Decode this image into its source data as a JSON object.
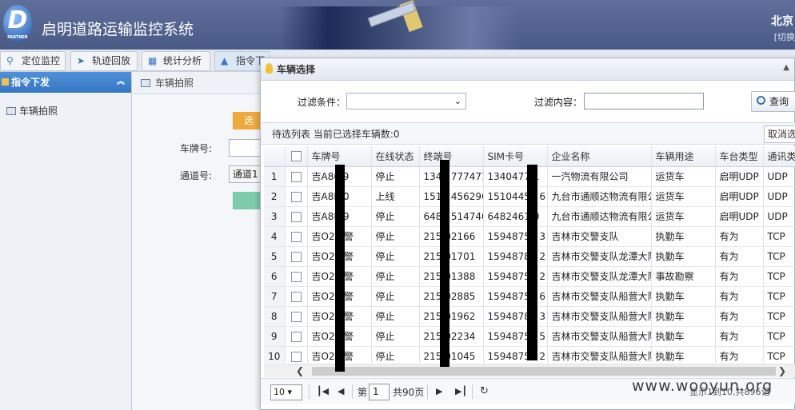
{
  "header": {
    "logo_letter": "D",
    "logo_sub": "PARTNER",
    "title": "启明道路运输监控系统",
    "city": "北京",
    "switch_link": "[切换"
  },
  "nav": {
    "tabs": [
      {
        "label": "定位监控",
        "icon": "pin-icon"
      },
      {
        "label": "轨迹回放",
        "icon": "send-icon"
      },
      {
        "label": "统计分析",
        "icon": "bar-chart-icon"
      },
      {
        "label": "指令下",
        "icon": "chart-area-icon"
      }
    ]
  },
  "sidebar": {
    "header": "指令下发",
    "items": [
      {
        "label": "车辆拍照"
      }
    ]
  },
  "content": {
    "tab_title": "车辆拍照",
    "select_btn": "选",
    "plate_label": "车牌号:",
    "channel_label": "通道号:",
    "channel_value": "通道1"
  },
  "dialog": {
    "title": "车辆选择",
    "filter_condition_label": "过滤条件：",
    "filter_condition_value": "",
    "filter_content_label": "过滤内容：",
    "filter_content_value": "",
    "query_btn": "查询",
    "list_status": "待选列表  当前已选择车辆数:0",
    "cancel_btn": "取消选",
    "columns": [
      "车牌号",
      "在线状态",
      "终端号",
      "SIM卡号",
      "企业名称",
      "车辆用途",
      "车台类型",
      "通讯类"
    ],
    "rows": [
      [
        "1",
        "吉A86  9",
        "停止",
        "1340 777471",
        "1340477  1",
        "一汽物流有限公司",
        "运货车",
        "启明UDP",
        "UDP"
      ],
      [
        "2",
        "吉A8K  0",
        "上线",
        "1510 456296",
        "15104456  6",
        "九台市通顺达物流有限公",
        "运货车",
        "启明UDP",
        "UDP"
      ],
      [
        "3",
        "吉A8K  9",
        "停止",
        "6482 514740",
        "6482461  0",
        "九台市通顺达物流有限公",
        "运货车",
        "启明UDP",
        "UDP"
      ],
      [
        "4",
        "吉O22  警",
        "停止",
        "215  02166",
        "15948754  3",
        "吉林市交警支队",
        "执勤车",
        "有为",
        "TCP"
      ],
      [
        "5",
        "吉O21  警",
        "停止",
        "215  01701",
        "15948784  2",
        "吉林市交警支队龙潭大队",
        "执勤车",
        "有为",
        "TCP"
      ],
      [
        "6",
        "吉O21  警",
        "停止",
        "215  01388",
        "15948754  2",
        "吉林市交警支队龙潭大队",
        "事故勘察",
        "有为",
        "TCP"
      ],
      [
        "7",
        "吉O22  警",
        "停止",
        "215  02885",
        "15948754  6",
        "吉林市交警支队船营大队",
        "执勤车",
        "有为",
        "TCP"
      ],
      [
        "8",
        "吉O21  警",
        "停止",
        "215  01962",
        "15948784  3",
        "吉林市交警支队船营大队",
        "执勤车",
        "有为",
        "TCP"
      ],
      [
        "9",
        "吉O21  警",
        "停止",
        "215  02234",
        "15948754  5",
        "吉林市交警支队船营大队",
        "执勤车",
        "有为",
        "TCP"
      ],
      [
        "10",
        "吉O21  警",
        "停止",
        "215  01045",
        "15948754  2",
        "吉林市交警支队船营大队",
        "执勤车",
        "有为",
        "TCP"
      ]
    ],
    "pager": {
      "page_size": "10",
      "page_label": "第",
      "page_value": "1",
      "total_pages": "共90页",
      "summary": "显示1到10,共896记"
    }
  },
  "watermark": "www.wooyun.org"
}
